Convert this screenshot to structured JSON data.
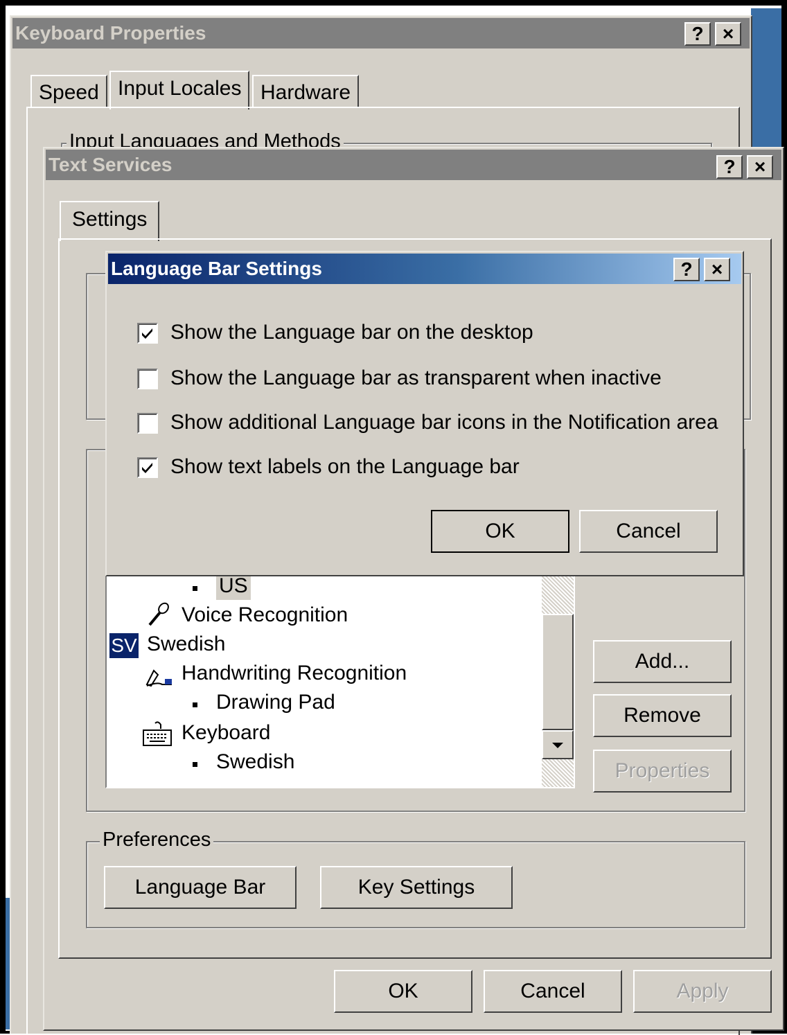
{
  "keyboard_properties": {
    "title": "Keyboard Properties",
    "help": "?",
    "close": "×",
    "tabs": [
      "Speed",
      "Input Locales",
      "Hardware"
    ],
    "group_label": "Input Languages and Methods"
  },
  "text_services": {
    "title": "Text Services",
    "help": "?",
    "close": "×",
    "tab": "Settings",
    "list": {
      "item_us": "US",
      "item_voice": "Voice Recognition",
      "lang_badge": "SV",
      "item_swedish": "Swedish",
      "item_handwriting": "Handwriting Recognition",
      "item_drawing_pad": "Drawing Pad",
      "item_keyboard": "Keyboard",
      "item_keyboard_swedish": "Swedish"
    },
    "buttons": {
      "add": "Add...",
      "remove": "Remove",
      "properties": "Properties"
    },
    "preferences": {
      "label": "Preferences",
      "language_bar": "Language Bar",
      "key_settings": "Key Settings"
    },
    "footer": {
      "ok": "OK",
      "cancel": "Cancel",
      "apply": "Apply"
    }
  },
  "language_bar_settings": {
    "title": "Language Bar Settings",
    "help": "?",
    "close": "×",
    "options": [
      {
        "label": "Show the Language bar on the desktop",
        "checked": true
      },
      {
        "label": "Show the Language bar as transparent when inactive",
        "checked": false
      },
      {
        "label": "Show additional Language bar icons in the Notification area",
        "checked": false
      },
      {
        "label": "Show text labels on the Language bar",
        "checked": true
      }
    ],
    "ok": "OK",
    "cancel": "Cancel"
  }
}
